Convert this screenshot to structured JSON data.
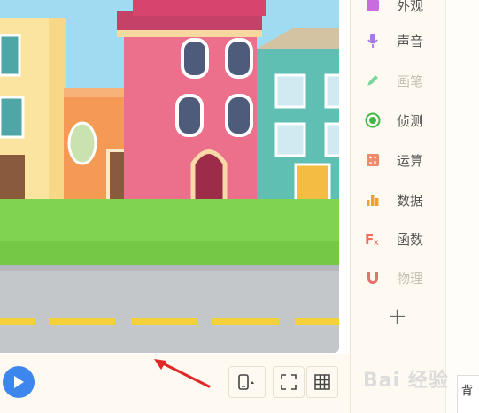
{
  "categories": [
    {
      "label": "外观",
      "icon": "appearance-icon",
      "color": "#c86ce0"
    },
    {
      "label": "声音",
      "icon": "microphone-icon",
      "color": "#a57ae2"
    },
    {
      "label": "画笔",
      "icon": "pen-icon",
      "color": "#7bd6a0"
    },
    {
      "label": "侦测",
      "icon": "detect-icon",
      "color": "#3fb848"
    },
    {
      "label": "运算",
      "icon": "calculator-icon",
      "color": "#f08a6c"
    },
    {
      "label": "数据",
      "icon": "bar-chart-icon",
      "color": "#f0a030"
    },
    {
      "label": "函数",
      "icon": "function-icon",
      "color": "#ee6d5c"
    },
    {
      "label": "物理",
      "icon": "magnet-icon",
      "color": "#e86f70"
    }
  ],
  "add_label": "+",
  "background_tab": "背",
  "watermark": "Bai 经验",
  "colors": {
    "play": "#3d86ee",
    "arrow": "#e02828",
    "accent": "#f4bc43"
  }
}
